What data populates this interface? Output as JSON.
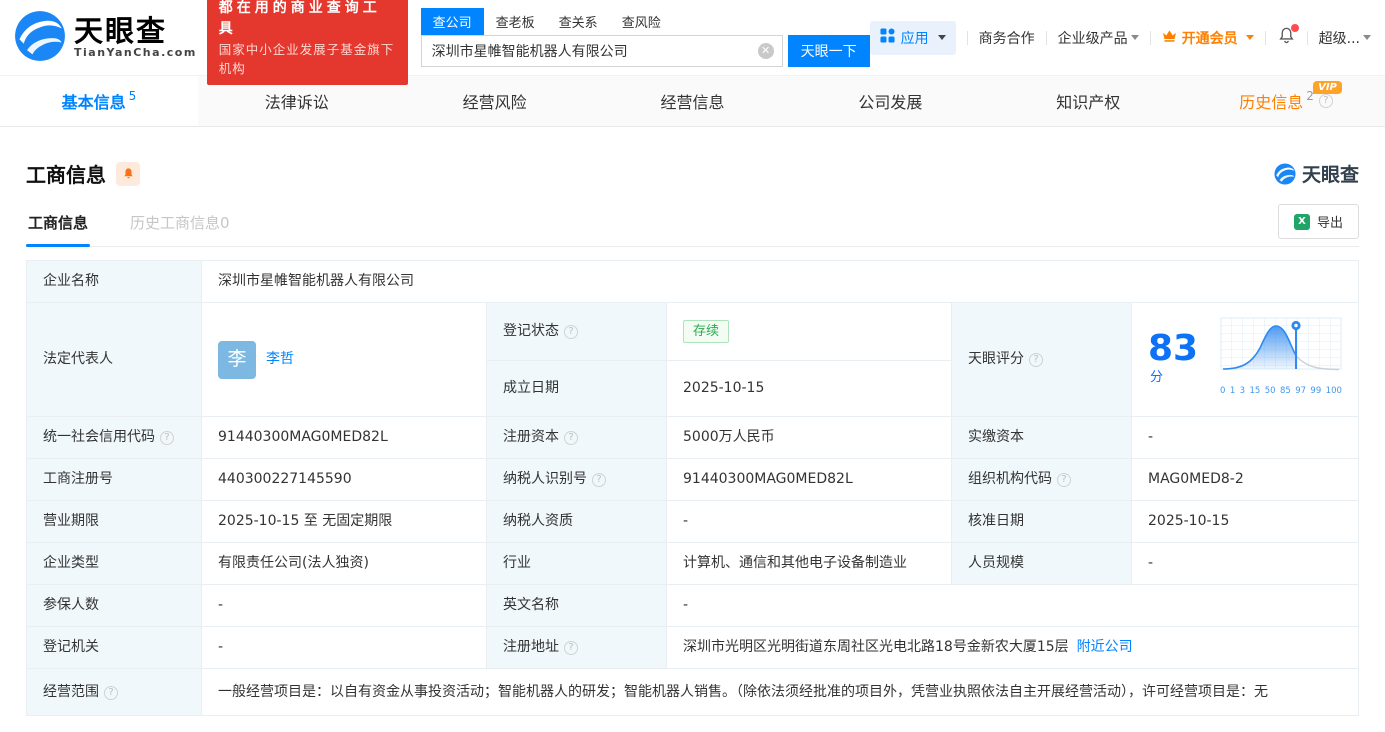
{
  "header": {
    "logo": {
      "title": "天眼查",
      "domain": "TianYanCha.com"
    },
    "promo": {
      "line1": "都在用的商业查询工具",
      "line2": "国家中小企业发展子基金旗下机构"
    },
    "search": {
      "tabs": [
        {
          "label": "查公司"
        },
        {
          "label": "查老板"
        },
        {
          "label": "查关系"
        },
        {
          "label": "查风险"
        }
      ],
      "value": "深圳市星帷智能机器人有限公司",
      "button": "天眼一下"
    },
    "nav": {
      "app": "应用",
      "cooperation": "商务合作",
      "enterprise": "企业级产品",
      "vip": "开通会员",
      "super_account": "超级..."
    }
  },
  "tabs": [
    {
      "label": "基本信息",
      "count": "5"
    },
    {
      "label": "法律诉讼"
    },
    {
      "label": "经营风险"
    },
    {
      "label": "经营信息"
    },
    {
      "label": "公司发展"
    },
    {
      "label": "知识产权"
    },
    {
      "label": "历史信息",
      "count": "2",
      "vip": "VIP"
    }
  ],
  "section": {
    "title": "工商信息",
    "watermark": "天眼查",
    "subtabs": [
      {
        "label": "工商信息"
      },
      {
        "label": "历史工商信息0"
      }
    ],
    "export_label": "导出"
  },
  "table": {
    "company_name_label": "企业名称",
    "company_name": "深圳市星帷智能机器人有限公司",
    "legal_rep_label": "法定代表人",
    "legal_rep_avatar": "李",
    "legal_rep_name": "李哲",
    "reg_status_label": "登记状态",
    "reg_status": "存续",
    "establish_date_label": "成立日期",
    "establish_date": "2025-10-15",
    "score_label": "天眼评分",
    "score_value": "83",
    "score_unit": "分",
    "credit_code_label": "统一社会信用代码",
    "credit_code": "91440300MAG0MED82L",
    "reg_capital_label": "注册资本",
    "reg_capital": "5000万人民币",
    "paid_capital_label": "实缴资本",
    "paid_capital": "-",
    "reg_number_label": "工商注册号",
    "reg_number": "440300227145590",
    "taxpayer_id_label": "纳税人识别号",
    "taxpayer_id": "91440300MAG0MED82L",
    "org_code_label": "组织机构代码",
    "org_code": "MAG0MED8-2",
    "business_term_label": "营业期限",
    "business_term": "2025-10-15 至 无固定期限",
    "taxpayer_quality_label": "纳税人资质",
    "taxpayer_quality": "-",
    "approval_date_label": "核准日期",
    "approval_date": "2025-10-15",
    "company_type_label": "企业类型",
    "company_type": "有限责任公司(法人独资)",
    "industry_label": "行业",
    "industry": "计算机、通信和其他电子设备制造业",
    "staff_size_label": "人员规模",
    "staff_size": "-",
    "insured_label": "参保人数",
    "insured": "-",
    "english_name_label": "英文名称",
    "english_name": "-",
    "reg_authority_label": "登记机关",
    "reg_authority": "-",
    "reg_address_label": "注册地址",
    "reg_address": "深圳市光明区光明街道东周社区光电北路18号金新农大厦15层",
    "nearby_link": "附近公司",
    "business_scope_label": "经营范围",
    "business_scope": "一般经营项目是：以自有资金从事投资活动；智能机器人的研发；智能机器人销售。（除依法须经批准的项目外，凭营业执照依法自主开展经营活动），许可经营项目是：无"
  },
  "score_chart": {
    "type": "area",
    "ticks": [
      "0",
      "1",
      "3",
      "15",
      "50",
      "85",
      "97",
      "99",
      "100"
    ],
    "marker_value": "83"
  }
}
